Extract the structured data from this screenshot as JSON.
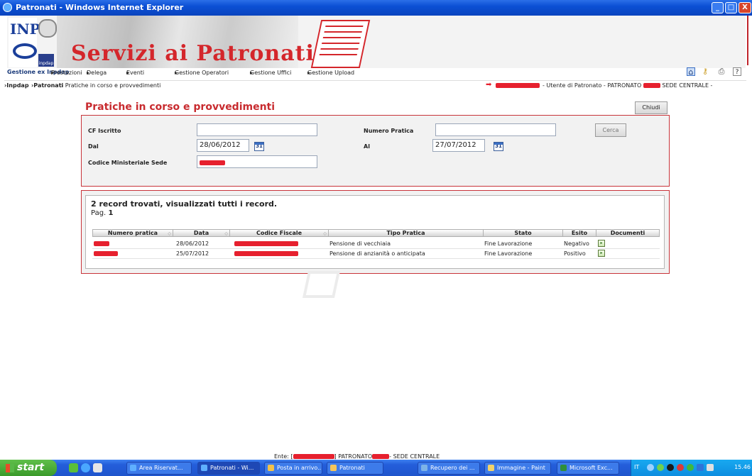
{
  "window": {
    "title": "Patronati - Windows Internet Explorer",
    "controls": {
      "minimize": "_",
      "maximize": "□",
      "close": "X"
    }
  },
  "header": {
    "logo_inps": "INPS",
    "logo_inpdap": "inpdap",
    "service_title": "Servizi ai Patronati"
  },
  "menu": {
    "home_label": "Gestione ex Inpdap",
    "items": [
      "Prestazioni",
      "Delega",
      "Eventi",
      "Gestione Operatori",
      "Gestione Uffici",
      "Gestione Upload"
    ],
    "arrow": "▸",
    "toolbar_icons": [
      "home-icon",
      "key-icon",
      "print-icon",
      "help-icon"
    ],
    "help_label": "?"
  },
  "breadcrumb": {
    "items": [
      "Inpdap",
      "Patronati",
      "Pratiche in corso e provvedimenti"
    ],
    "user_info_prefix": "- Utente di Patronato - PATRONATO",
    "user_info_suffix": "SEDE CENTRALE -"
  },
  "page": {
    "title": "Pratiche in corso e provvedimenti",
    "close_label": "Chiudi"
  },
  "search": {
    "cf_label": "CF Iscritto",
    "cf_value": "",
    "numero_label": "Numero Pratica",
    "numero_value": "",
    "dal_label": "Dal",
    "dal_value": "28/06/2012",
    "al_label": "Al",
    "al_value": "27/07/2012",
    "calendar_icon_text": "31",
    "sede_label": "Codice Ministeriale Sede",
    "search_label": "Cerca"
  },
  "results": {
    "summary": "2 record trovati, visualizzati tutti i record.",
    "page_label": "Pag.",
    "page_number": "1",
    "columns": [
      "Numero pratica",
      "Data",
      "Codice Fiscale",
      "Tipo Pratica",
      "Stato",
      "Esito",
      "Documenti"
    ],
    "rows": [
      {
        "data": "28/06/2012",
        "tipo": "Pensione di vecchiaia",
        "stato": "Fine Lavorazione",
        "esito": "Negativo"
      },
      {
        "data": "25/07/2012",
        "tipo": "Pensione di anzianità o anticipata",
        "stato": "Fine Lavorazione",
        "esito": "Positivo"
      }
    ]
  },
  "statusbar": {
    "prefix": "Ente: [",
    "middle": "] PATRONATO",
    "suffix": "- SEDE CENTRALE"
  },
  "taskbar": {
    "start_label": "start",
    "tasks": [
      "Area Riservat...",
      "Patronati - Wi...",
      "Posta in arrivo...",
      "Patronati",
      "Recupero dei ...",
      "Immagine - Paint",
      "Microsoft Exc..."
    ],
    "language": "IT",
    "clock": "15.46"
  },
  "colors": {
    "brand_red": "#c82b2f",
    "redaction": "#e6202e",
    "taskbar_blue": "#245edb"
  }
}
